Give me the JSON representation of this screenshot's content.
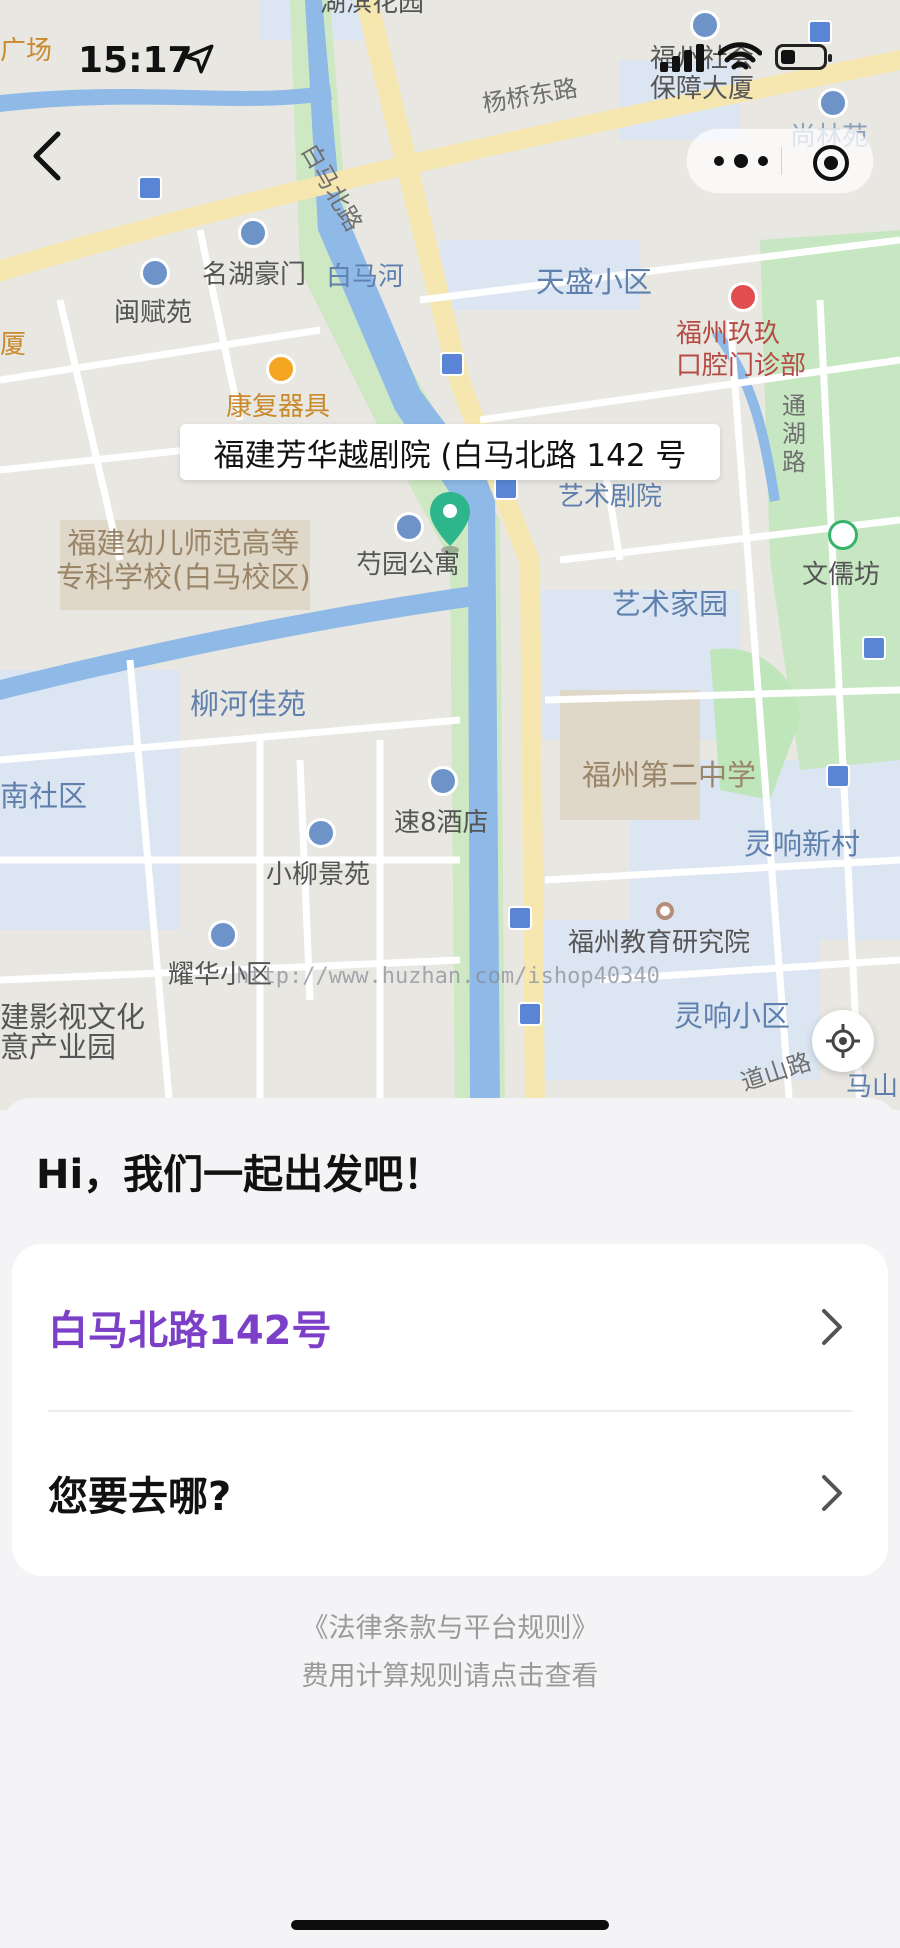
{
  "status_bar": {
    "time": "15:17"
  },
  "map": {
    "callout": "福建芳华越剧院 (白马北路 142 号",
    "labels": {
      "hubin": "湖滨花园",
      "guangchang": "广场",
      "yangqiao": "杨桥东路",
      "shebao": "福州社会\n保障大厦",
      "shanglin": "尚林苑",
      "baima_road": "白马北路",
      "minghu": "名湖豪门",
      "baimahe": "白马河",
      "tiansheng": "天盛小区",
      "minfu": "闽赋苑",
      "jiujiu": "福州玖玖\n口腔门诊部",
      "xia": "厦",
      "kangfu": "康复器具",
      "tonghu": "通\n湖\n路",
      "yishu": "艺术剧院",
      "youer": "福建幼儿师范高等\n专科学校(白马校区)",
      "shaoyuan": "芍园公寓",
      "wenru": "文儒坊",
      "yishujiayuan": "艺术家园",
      "liuhe": "柳河佳苑",
      "fzer": "福州第二中学",
      "nanshequ": "南社区",
      "su8": "速8酒店",
      "lingxiang": "灵响新村",
      "xiaoliu": "小柳景苑",
      "jiaoyu": "福州教育研究院",
      "yaohua": "耀华小区",
      "yingshi": "建影视文化\n意产业园",
      "lingxiangxq": "灵响小区",
      "daoshan": "道山路",
      "mashan": "马山",
      "watermark": "http://www.huzhan.com/ishop40340"
    }
  },
  "sheet": {
    "greeting": "Hi，我们一起出发吧！",
    "origin": "白马北路142号",
    "destination_placeholder": "您要去哪?",
    "legal_link": "《法律条款与平台规则》",
    "fee_link": "费用计算规则请点击查看"
  }
}
